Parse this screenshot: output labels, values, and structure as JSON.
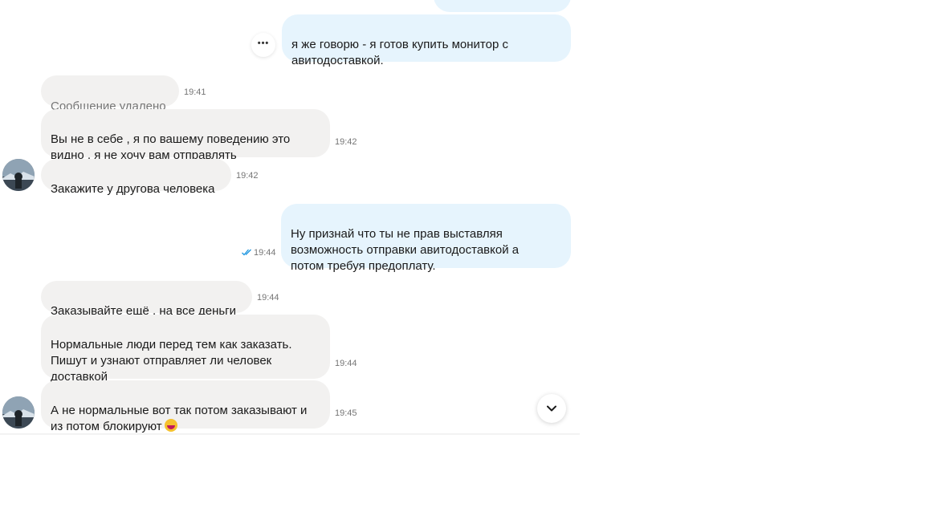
{
  "messages": [
    {
      "id": "m1",
      "direction": "out",
      "text": "я же говорю - я готов купить монитор с\nавитодоставкой.",
      "time": ""
    },
    {
      "id": "m2",
      "direction": "in",
      "text": "Сообщение удалено",
      "time": "19:41",
      "deleted": true
    },
    {
      "id": "m3",
      "direction": "in",
      "text": "Вы  не в себе , я по вашему поведению это\nвидно , я не хочу вам отправлять",
      "time": "19:42"
    },
    {
      "id": "m4",
      "direction": "in",
      "text": "Закажите у другова человека",
      "time": "19:42"
    },
    {
      "id": "m5",
      "direction": "out",
      "text": "Ну признай что ты не прав выставляя\nвозможность отправки авитодоставкой а\nпотом требуя предоплату.",
      "time": "19:44",
      "read": true
    },
    {
      "id": "m6",
      "direction": "in",
      "text": "Заказывайте ещё ,  на все деньги",
      "time": "19:44"
    },
    {
      "id": "m7",
      "direction": "in",
      "text": "Нормальные люди перед тем как заказать.\nПишут и узнают отправляет ли человек\nдоставкой",
      "time": "19:44"
    },
    {
      "id": "m8",
      "direction": "in",
      "text": "А не нормальные вот так потом заказывают и\nиз потом блокируют",
      "time": "19:45",
      "emoji": "laughing-emoji"
    }
  ],
  "icons": {
    "more": "more-dots-icon",
    "scroll_down": "chevron-down-icon",
    "read": "double-check-icon"
  },
  "more_label": "•••",
  "colors": {
    "incoming_bubble": "#f2f1f0",
    "outgoing_bubble": "#e6f4fd",
    "read_check": "#1e96e0",
    "time_text": "#757575"
  }
}
